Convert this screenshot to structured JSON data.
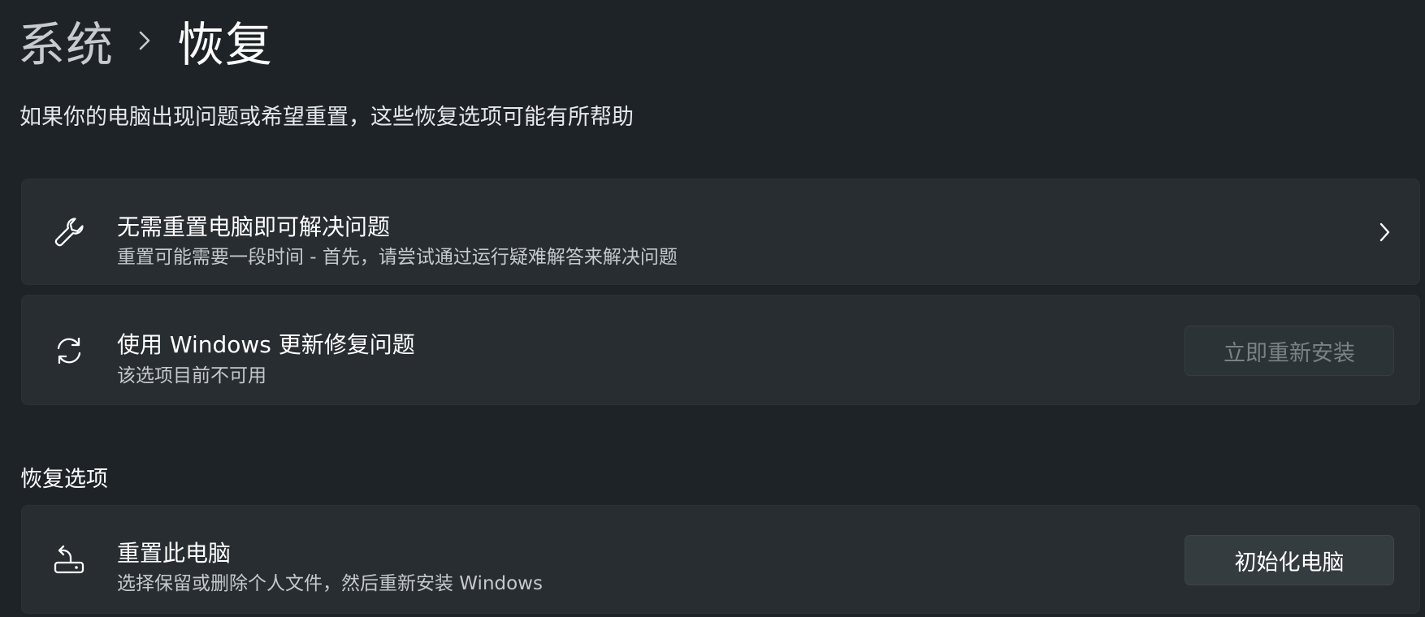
{
  "breadcrumb": {
    "parent": "系统",
    "separator_icon": "chevron-right-icon",
    "current": "恢复"
  },
  "intro": "如果你的电脑出现问题或希望重置，这些恢复选项可能有所帮助",
  "cards": [
    {
      "icon": "wrench-icon",
      "title": "无需重置电脑即可解决问题",
      "description": "重置可能需要一段时间 - 首先，请尝试通过运行疑难解答来解决问题",
      "action_icon": "chevron-right-icon"
    },
    {
      "icon": "refresh-icon",
      "title": "使用 Windows 更新修复问题",
      "description": "该选项目前不可用",
      "button": "立即重新安装",
      "button_state": "disabled"
    }
  ],
  "section": {
    "heading": "恢复选项",
    "items": [
      {
        "icon": "reset-pc-icon",
        "title": "重置此电脑",
        "description": "选择保留或删除个人文件，然后重新安装 Windows",
        "button": "初始化电脑"
      }
    ]
  },
  "colors": {
    "background": "#1d2327",
    "card": "#272d31",
    "text_primary": "#ffffff",
    "text_secondary": "#c5c9cc",
    "button_disabled_text": "#7b8287"
  }
}
